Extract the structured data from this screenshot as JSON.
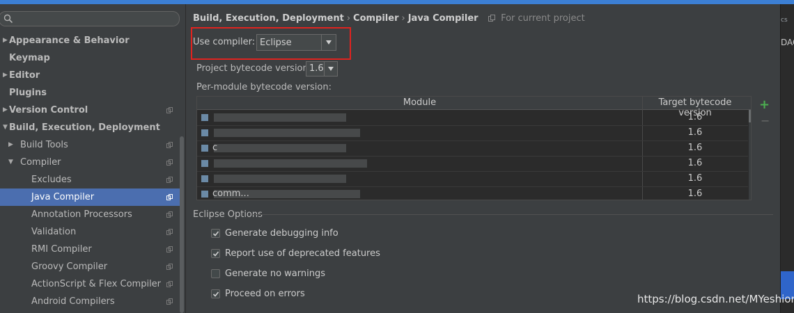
{
  "sidebar": {
    "items": [
      {
        "label": "Appearance & Behavior",
        "arrow": "▶",
        "bold": true,
        "indent": 0,
        "copy": false,
        "selected": false
      },
      {
        "label": "Keymap",
        "arrow": "",
        "bold": true,
        "indent": 0,
        "copy": false,
        "selected": false
      },
      {
        "label": "Editor",
        "arrow": "▶",
        "bold": true,
        "indent": 0,
        "copy": false,
        "selected": false
      },
      {
        "label": "Plugins",
        "arrow": "",
        "bold": true,
        "indent": 0,
        "copy": false,
        "selected": false
      },
      {
        "label": "Version Control",
        "arrow": "▶",
        "bold": true,
        "indent": 0,
        "copy": true,
        "selected": false
      },
      {
        "label": "Build, Execution, Deployment",
        "arrow": "▼",
        "bold": true,
        "indent": 0,
        "copy": false,
        "selected": false
      },
      {
        "label": "Build Tools",
        "arrow": "▶",
        "bold": false,
        "indent": 1,
        "copy": true,
        "selected": false
      },
      {
        "label": "Compiler",
        "arrow": "▼",
        "bold": false,
        "indent": 1,
        "copy": true,
        "selected": false
      },
      {
        "label": "Excludes",
        "arrow": "",
        "bold": false,
        "indent": 2,
        "copy": true,
        "selected": false
      },
      {
        "label": "Java Compiler",
        "arrow": "",
        "bold": false,
        "indent": 2,
        "copy": true,
        "selected": true
      },
      {
        "label": "Annotation Processors",
        "arrow": "",
        "bold": false,
        "indent": 2,
        "copy": true,
        "selected": false
      },
      {
        "label": "Validation",
        "arrow": "",
        "bold": false,
        "indent": 2,
        "copy": true,
        "selected": false
      },
      {
        "label": "RMI Compiler",
        "arrow": "",
        "bold": false,
        "indent": 2,
        "copy": true,
        "selected": false
      },
      {
        "label": "Groovy Compiler",
        "arrow": "",
        "bold": false,
        "indent": 2,
        "copy": true,
        "selected": false
      },
      {
        "label": "ActionScript & Flex Compiler",
        "arrow": "",
        "bold": false,
        "indent": 2,
        "copy": true,
        "selected": false
      },
      {
        "label": "Android Compilers",
        "arrow": "",
        "bold": false,
        "indent": 2,
        "copy": true,
        "selected": false
      }
    ]
  },
  "breadcrumb": {
    "items": [
      "Build, Execution, Deployment",
      "Compiler",
      "Java Compiler"
    ],
    "sep": "›",
    "scope": "For current project"
  },
  "compiler": {
    "use_label": "Use compiler:",
    "use_value": "Eclipse",
    "bytecode_label": "Project bytecode version:",
    "bytecode_value": "1.6",
    "per_module_label": "Per-module bytecode version:"
  },
  "table": {
    "columns": [
      "Module",
      "Target bytecode version"
    ],
    "rows": [
      {
        "module": "",
        "version": "1.6"
      },
      {
        "module": "",
        "version": "1.6"
      },
      {
        "module": "c",
        "version": "1.6"
      },
      {
        "module": "",
        "version": "1.6"
      },
      {
        "module": "",
        "version": "1.6"
      },
      {
        "module": "comm...",
        "version": "1.6"
      }
    ],
    "add_symbol": "+",
    "remove_symbol": "−"
  },
  "eclipse": {
    "title": "Eclipse Options",
    "options": [
      {
        "label": "Generate debugging info",
        "checked": true
      },
      {
        "label": "Report use of deprecated features",
        "checked": true
      },
      {
        "label": "Generate no warnings",
        "checked": false
      },
      {
        "label": "Proceed on errors",
        "checked": true
      }
    ]
  },
  "right_strip": {
    "text1": "cs",
    "text2": "DAC"
  },
  "watermark": "https://blog.csdn.net/MYeshion",
  "colors": {
    "selection": "#4b6eaf",
    "highlight": "#e0231f",
    "accent": "#3c7fd4"
  }
}
